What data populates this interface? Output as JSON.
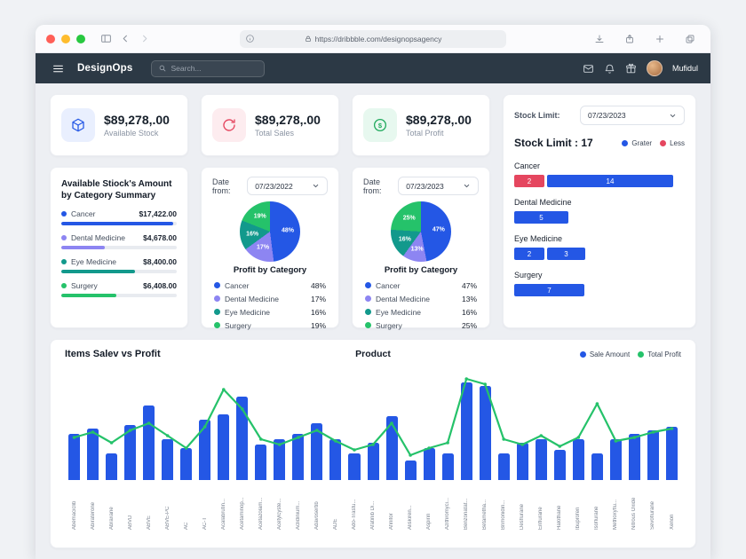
{
  "browser": {
    "url": "https://dribbble.com/designopsagency"
  },
  "app_header": {
    "brand": "DesignOps",
    "search_placeholder": "Search...",
    "user_name": "Mufidul"
  },
  "stat_cards": [
    {
      "value": "$89,278,.00",
      "label": "Available Stock"
    },
    {
      "value": "$89,278,.00",
      "label": "Total Sales"
    },
    {
      "value": "$89,278,.00",
      "label": "Total Profit"
    }
  ],
  "stock_limit_card": {
    "filter_label": "Stock Limit:",
    "date_value": "07/23/2023",
    "title": "Stock Limit : 17",
    "legend": [
      {
        "label": "Grater",
        "color": "#2457e5"
      },
      {
        "label": "Less",
        "color": "#e5465f"
      }
    ]
  },
  "category_summary_card": {
    "title": "Available Stiock's Amount by Category Summary",
    "items": [
      {
        "name": "Cancer",
        "amount": "$17,422.00",
        "color": "#2457e5",
        "progress": 97
      },
      {
        "name": "Dental Medicine",
        "amount": "$4,678.00",
        "color": "#8d85f2",
        "progress": 38
      },
      {
        "name": "Eye Medicine",
        "amount": "$8,400.00",
        "color": "#12998c",
        "progress": 64
      },
      {
        "name": "Surgery",
        "amount": "$6,408.00",
        "color": "#25c26a",
        "progress": 48
      }
    ]
  },
  "pie_cards": [
    {
      "date_label": "Date from:",
      "date_value": "07/23/2022",
      "title": "Profit by Category"
    },
    {
      "date_label": "Date from:",
      "date_value": "07/23/2023",
      "title": "Profit by Category"
    }
  ],
  "items_chart_card": {
    "title": "Items Salev vs Profit",
    "axis_title": "Product"
  },
  "chart_data": [
    {
      "name": "stock_limit_by_category",
      "type": "bar",
      "orientation": "horizontal",
      "title": "Stock Limit : 17",
      "legend": [
        "Grater",
        "Less"
      ],
      "rows": [
        {
          "category": "Cancer",
          "segments": [
            {
              "value": 2,
              "color": "#e5465f"
            },
            {
              "value": 14,
              "color": "#2457e5"
            }
          ]
        },
        {
          "category": "Dental Medicine",
          "segments": [
            {
              "value": 5,
              "color": "#2457e5"
            }
          ]
        },
        {
          "category": "Eye Medicine",
          "segments": [
            {
              "value": 2,
              "color": "#2457e5"
            },
            {
              "value": 3,
              "color": "#2457e5"
            }
          ]
        },
        {
          "category": "Surgery",
          "segments": [
            {
              "value": 7,
              "color": "#2457e5"
            }
          ]
        }
      ]
    },
    {
      "name": "profit_by_category_2022",
      "type": "pie",
      "title": "Profit by Category",
      "date_from": "07/23/2022",
      "slices": [
        {
          "name": "Cancer",
          "pct": 48,
          "color": "#2457e5"
        },
        {
          "name": "Dental Medicine",
          "pct": 17,
          "color": "#8d85f2"
        },
        {
          "name": "Eye Medicine",
          "pct": 16,
          "color": "#12998c"
        },
        {
          "name": "Surgery",
          "pct": 19,
          "color": "#25c26a"
        }
      ]
    },
    {
      "name": "profit_by_category_2023",
      "type": "pie",
      "title": "Profit by Category",
      "date_from": "07/23/2023",
      "slices": [
        {
          "name": "Cancer",
          "pct": 47,
          "color": "#2457e5"
        },
        {
          "name": "Dental Medicine",
          "pct": 13,
          "color": "#8d85f2"
        },
        {
          "name": "Eye Medicine",
          "pct": 16,
          "color": "#12998c"
        },
        {
          "name": "Surgery",
          "pct": 25,
          "color": "#25c26a"
        }
      ]
    },
    {
      "name": "items_sale_vs_profit",
      "type": "bar",
      "title": "Items Salev vs Profit",
      "xlabel": "Product",
      "ylim": [
        0,
        128
      ],
      "categories": [
        "Abemaciclib",
        "Abiraterone",
        "Abraxane",
        "ABVD",
        "ABVE",
        "ABVE-PC",
        "AC",
        "AC-T",
        "Acalabrutin...",
        "Acetaminop...",
        "Acetazolam...",
        "Acetylcyste...",
        "Aclidinium...",
        "Adavosertib",
        "ADE",
        "Ado-Trastu...",
        "Afatinib Di...",
        "Afinitor",
        "Aliskiren...",
        "Aspirin",
        "Azithromyci...",
        "Benzonatat...",
        "Betametha...",
        "Brimonidin...",
        "Desflurane",
        "Enflurane",
        "Halothane",
        "Ibuprofen",
        "Isoflurane",
        "Methoxyflu...",
        "Nitrous Oxide",
        "Sevoflurane",
        "Xenon"
      ],
      "series": [
        {
          "name": "Sale Amount",
          "type": "bar",
          "color": "#2457e5",
          "values": [
            52,
            58,
            30,
            62,
            84,
            46,
            36,
            68,
            74,
            94,
            40,
            46,
            52,
            64,
            46,
            30,
            42,
            72,
            22,
            36,
            30,
            110,
            106,
            30,
            42,
            46,
            34,
            46,
            30,
            46,
            52,
            56,
            60
          ]
        },
        {
          "name": "Total Profit",
          "type": "line",
          "color": "#25c26a",
          "values": [
            48,
            54,
            42,
            56,
            64,
            50,
            36,
            60,
            102,
            80,
            46,
            40,
            48,
            56,
            44,
            34,
            40,
            64,
            28,
            36,
            42,
            114,
            108,
            46,
            40,
            50,
            38,
            48,
            86,
            44,
            48,
            54,
            58
          ]
        }
      ]
    }
  ]
}
